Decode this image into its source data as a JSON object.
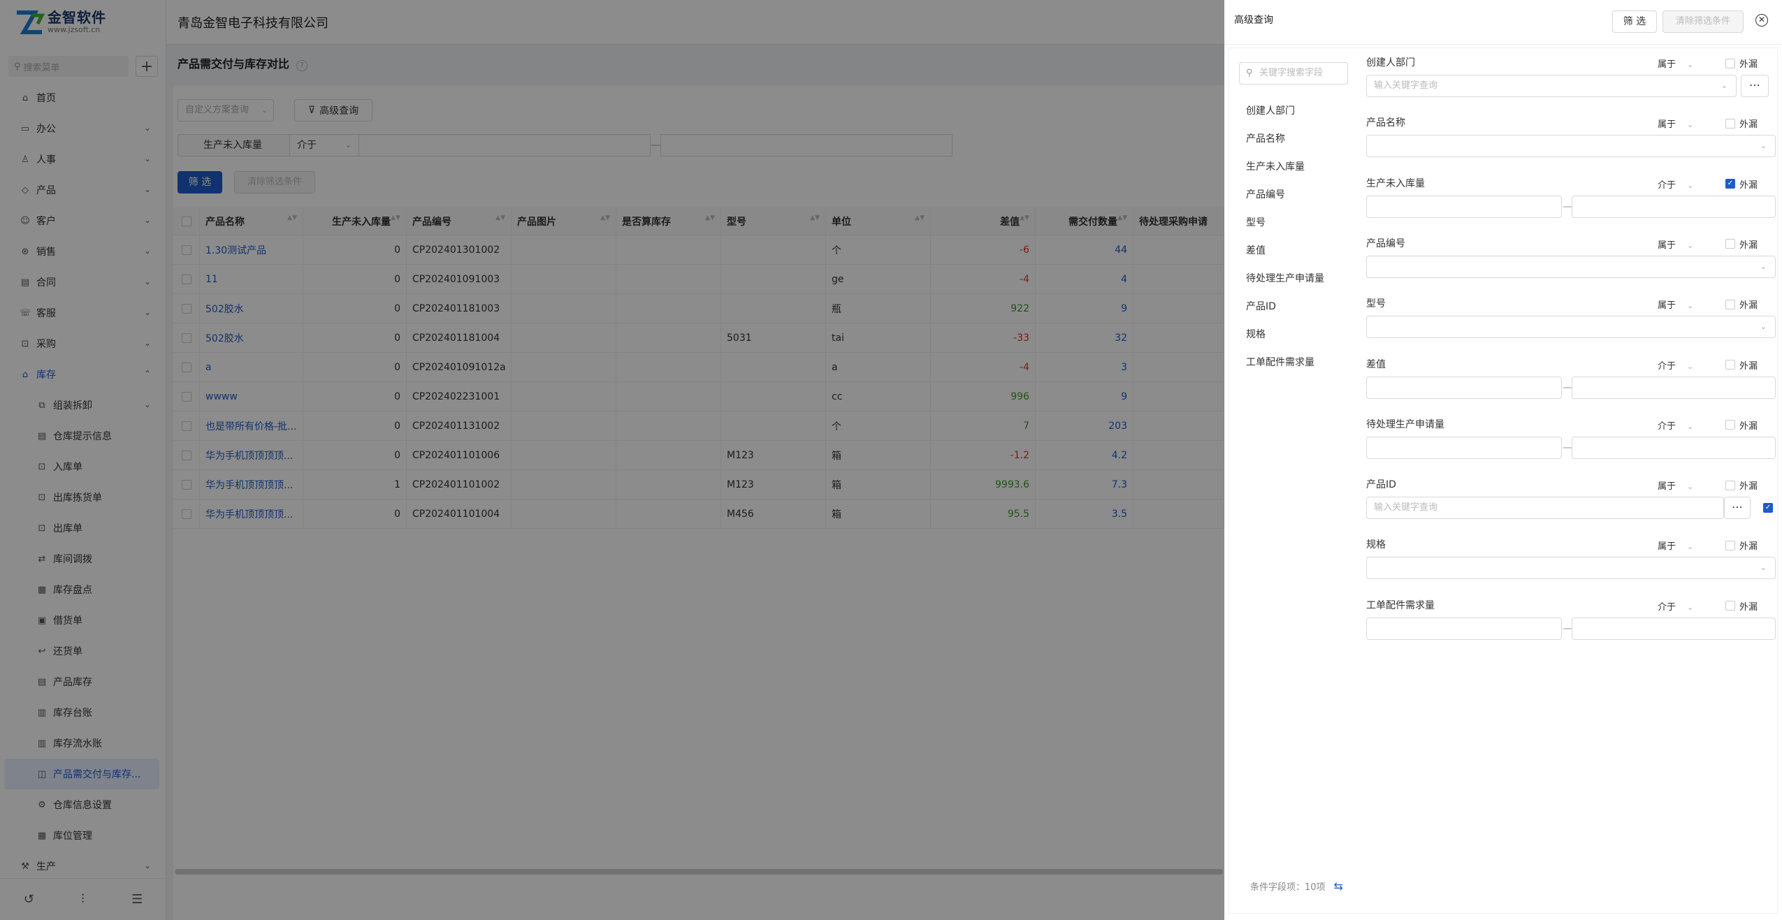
{
  "logo": {
    "name": "金智软件",
    "url": "www.jzsoft.cn"
  },
  "company": "青岛金智电子科技有限公司",
  "sidebar": {
    "search_placeholder": "搜索菜单",
    "items": [
      {
        "label": "首页",
        "icon": "home-icon"
      },
      {
        "label": "办公",
        "icon": "office-icon"
      },
      {
        "label": "人事",
        "icon": "people-icon"
      },
      {
        "label": "产品",
        "icon": "product-icon"
      },
      {
        "label": "客户",
        "icon": "customer-icon"
      },
      {
        "label": "销售",
        "icon": "sales-icon"
      },
      {
        "label": "合同",
        "icon": "contract-icon"
      },
      {
        "label": "客服",
        "icon": "service-icon"
      },
      {
        "label": "采购",
        "icon": "purchase-icon"
      },
      {
        "label": "库存",
        "icon": "warehouse-icon"
      }
    ],
    "sub_items": [
      "组装拆卸",
      "仓库提示信息",
      "入库单",
      "出库拣货单",
      "出库单",
      "库间调拨",
      "库存盘点",
      "借货单",
      "还货单",
      "产品库存",
      "库存台账",
      "库存流水账",
      "产品需交付与库存...",
      "仓库信息设置",
      "库位管理"
    ],
    "last_item": "生产"
  },
  "page": {
    "title": "产品需交付与库存对比",
    "scheme_placeholder": "自定义方案查询",
    "adv_label": "高级查询"
  },
  "filter": {
    "field": "生产未入库量",
    "op": "介于",
    "btn_filter": "筛 选",
    "btn_clear": "清除筛选条件"
  },
  "table": {
    "headers": [
      "产品名称",
      "生产未入库量",
      "产品编号",
      "产品图片",
      "是否算库存",
      "型号",
      "单位",
      "差值",
      "需交付数量",
      "待处理采购申请"
    ],
    "rows": [
      {
        "name": "1.30测试产品",
        "qty": "0",
        "code": "CP202401301002",
        "model": "",
        "unit": "个",
        "diff": "-6",
        "need": "44"
      },
      {
        "name": "11",
        "qty": "0",
        "code": "CP202401091003",
        "model": "",
        "unit": "ge",
        "diff": "-4",
        "need": "4"
      },
      {
        "name": "502胶水",
        "qty": "0",
        "code": "CP202401181003",
        "model": "",
        "unit": "瓶",
        "diff": "922",
        "need": "9"
      },
      {
        "name": "502胶水",
        "qty": "0",
        "code": "CP202401181004",
        "model": "5031",
        "unit": "tai",
        "diff": "-33",
        "need": "32"
      },
      {
        "name": "a",
        "qty": "0",
        "code": "CP202401091012a",
        "model": "",
        "unit": "a",
        "diff": "-4",
        "need": "3"
      },
      {
        "name": "wwww",
        "qty": "0",
        "code": "CP202402231001",
        "model": "",
        "unit": "cc",
        "diff": "996",
        "need": "9"
      },
      {
        "name": "也是带所有价格-批...",
        "qty": "0",
        "code": "CP202401131002",
        "model": "",
        "unit": "个",
        "diff": "7",
        "need": "203"
      },
      {
        "name": "华为手机顶顶顶顶...",
        "qty": "0",
        "code": "CP202401101006",
        "model": "M123",
        "unit": "箱",
        "diff": "-1.2",
        "need": "4.2"
      },
      {
        "name": "华为手机顶顶顶顶...",
        "qty": "1",
        "code": "CP202401101002",
        "model": "M123",
        "unit": "箱",
        "diff": "9993.6",
        "need": "7.3"
      },
      {
        "name": "华为手机顶顶顶顶...",
        "qty": "0",
        "code": "CP202401101004",
        "model": "M456",
        "unit": "箱",
        "diff": "95.5",
        "need": "3.5"
      }
    ]
  },
  "drawer": {
    "title": "高级查询",
    "btn_filter": "筛 选",
    "btn_clear": "清除筛选条件",
    "search_placeholder": "关键字搜索字段",
    "field_list": [
      "创建人部门",
      "产品名称",
      "生产未入库量",
      "产品编号",
      "型号",
      "差值",
      "待处理生产申请量",
      "产品ID",
      "规格",
      "工单配件需求量"
    ],
    "outer": "外漏",
    "op_in": "属于",
    "op_between": "介于",
    "keyword_placeholder": "输入关键字查询",
    "footer": "条件字段项：10项"
  },
  "colors": {
    "primary": "#1e5cc9",
    "negative": "#e0312e",
    "positive": "#3a9a28"
  }
}
